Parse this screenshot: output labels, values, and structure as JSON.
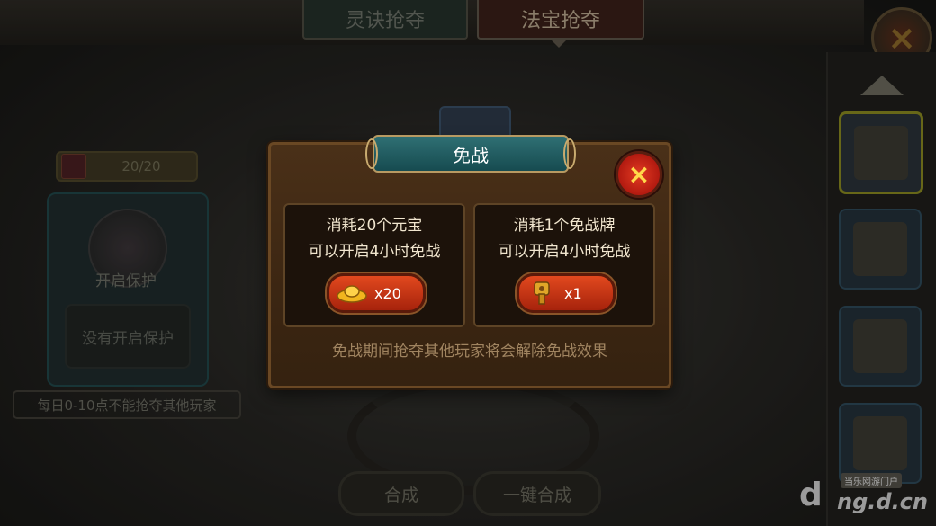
{
  "tabs": [
    {
      "label": "灵诀抢夺"
    },
    {
      "label": "法宝抢夺"
    }
  ],
  "left_panel": {
    "counter": "20/20",
    "protect_label": "开启保护",
    "no_protect_button": "没有开启保护",
    "notice": "每日0-10点不能抢夺其他玩家"
  },
  "bottom_buttons": {
    "compose": "合成",
    "one_key_compose": "一键合成"
  },
  "watermark": {
    "tag": "当乐网游门户",
    "url": "ng.d.cn",
    "logo": "d"
  },
  "dialog": {
    "title": "免战",
    "close_icon": "×",
    "option1": {
      "line1": "消耗20个元宝",
      "line2": "可以开启4小时免战",
      "icon": "gold-ingot-icon",
      "count": "x20"
    },
    "option2": {
      "line1": "消耗1个免战牌",
      "line2": "可以开启4小时免战",
      "icon": "truce-token-icon",
      "count": "x1"
    },
    "footer": "免战期间抢夺其他玩家将会解除免战效果"
  },
  "colors": {
    "accent_teal": "#2f6f73",
    "button_red": "#c8321a",
    "dialog_brown": "#3c2612",
    "text_cream": "#f1e6cf"
  }
}
